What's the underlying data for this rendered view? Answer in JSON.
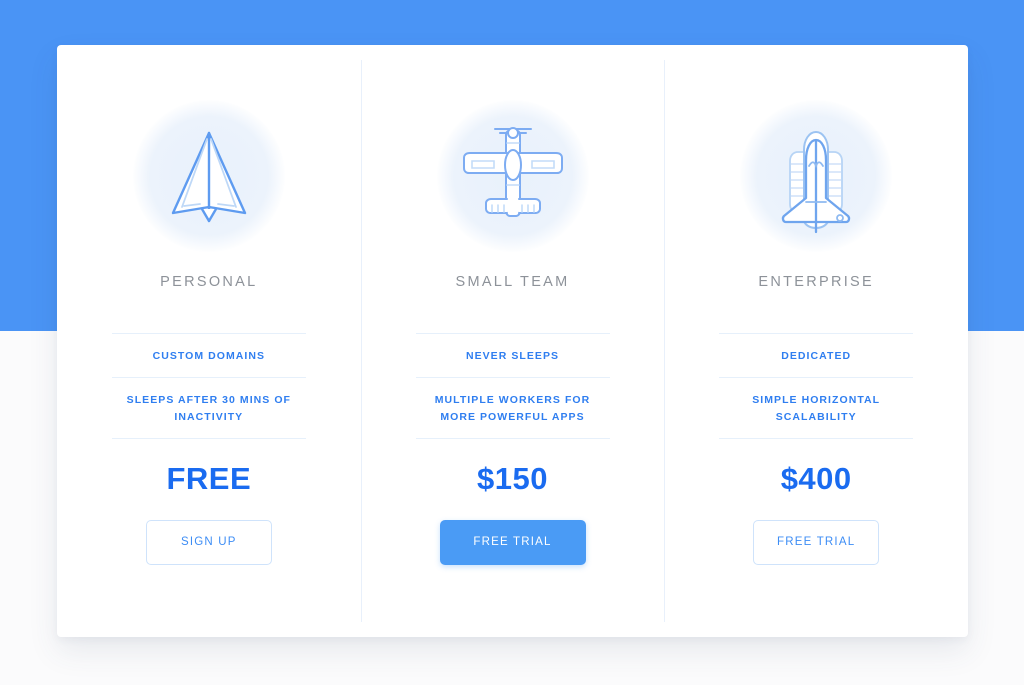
{
  "theme": {
    "band_color": "#4a94f5",
    "accent_blue": "#4a9bf5",
    "price_blue": "#1a6bf0",
    "feature_blue": "#2f7ef0",
    "title_gray": "#8d9299",
    "divider": "#e6f0fb",
    "card_bg": "#ffffff",
    "page_bg": "#fbfbfc"
  },
  "plans": [
    {
      "id": "personal",
      "name": "PERSONAL",
      "icon": "paper-plane-icon",
      "features": [
        "CUSTOM DOMAINS",
        "SLEEPS AFTER 30 MINS OF INACTIVITY"
      ],
      "price": "FREE",
      "cta_label": "SIGN UP",
      "cta_style": "outline"
    },
    {
      "id": "small-team",
      "name": "SMALL TEAM",
      "icon": "propeller-plane-icon",
      "features": [
        "NEVER SLEEPS",
        "MULTIPLE WORKERS FOR MORE POWERFUL APPS"
      ],
      "price": "$150",
      "cta_label": "FREE TRIAL",
      "cta_style": "filled"
    },
    {
      "id": "enterprise",
      "name": "ENTERPRISE",
      "icon": "space-shuttle-icon",
      "features": [
        "DEDICATED",
        "SIMPLE HORIZONTAL SCALABILITY"
      ],
      "price": "$400",
      "cta_label": "FREE TRIAL",
      "cta_style": "outline"
    }
  ]
}
